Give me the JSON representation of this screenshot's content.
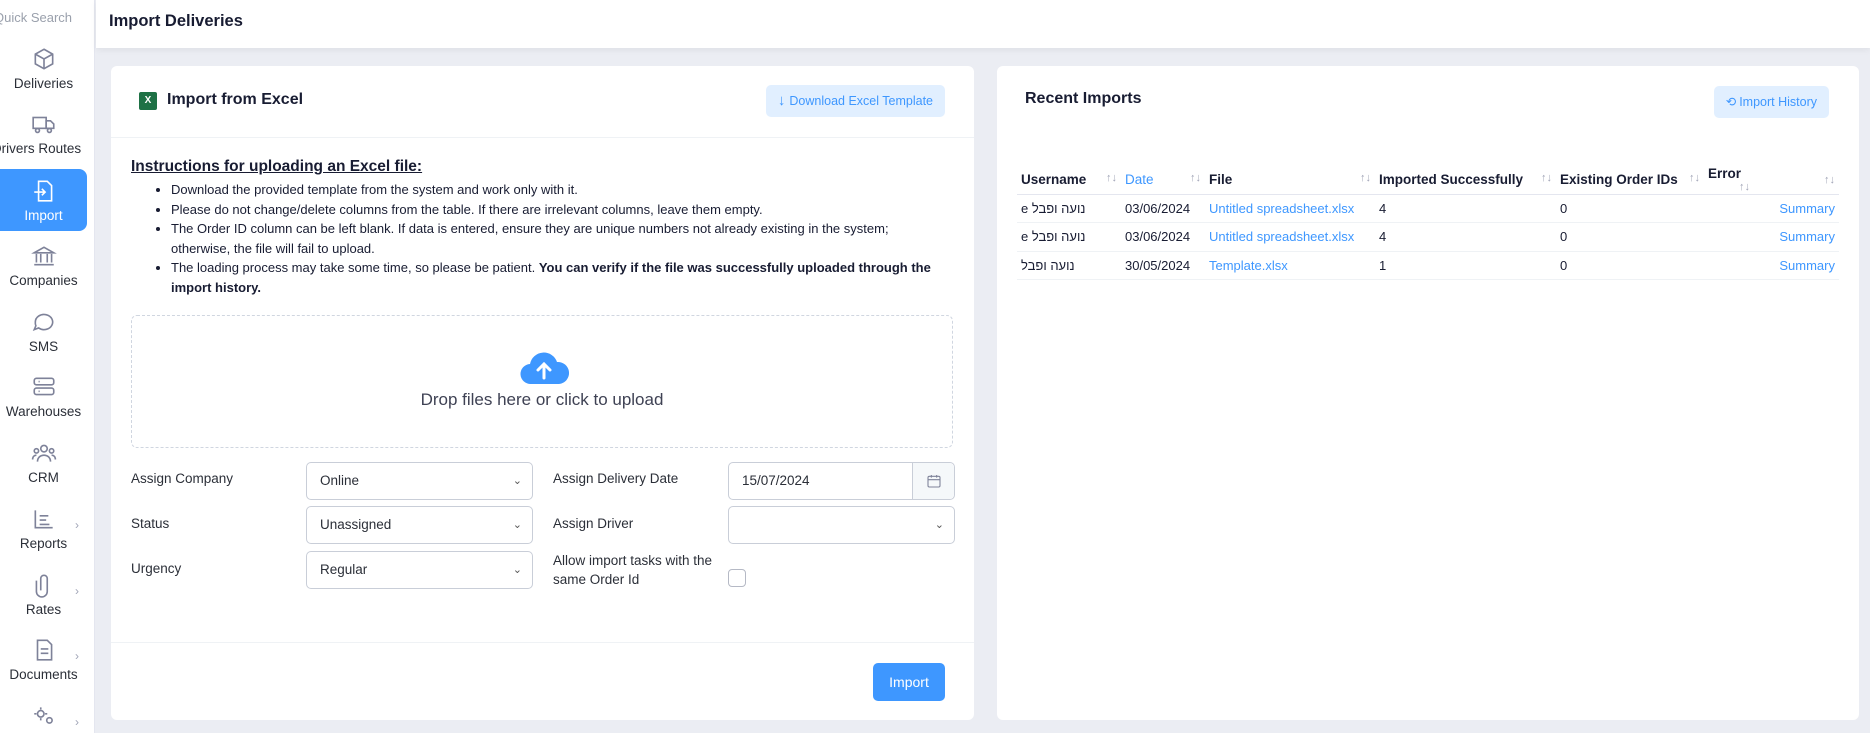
{
  "sidebar": {
    "search_placeholder": "Quick Search",
    "items": [
      {
        "label": "Deliveries",
        "icon": "box-icon"
      },
      {
        "label": "Drivers Routes",
        "icon": "truck-icon"
      },
      {
        "label": "Import",
        "icon": "import-icon",
        "active": true
      },
      {
        "label": "Companies",
        "icon": "bank-icon"
      },
      {
        "label": "SMS",
        "icon": "chat-icon"
      },
      {
        "label": "Warehouses",
        "icon": "server-icon"
      },
      {
        "label": "CRM",
        "icon": "users-icon"
      },
      {
        "label": "Reports",
        "icon": "chart-icon",
        "expandable": true
      },
      {
        "label": "Rates",
        "icon": "paperclip-icon",
        "expandable": true
      },
      {
        "label": "Documents",
        "icon": "document-icon",
        "expandable": true
      },
      {
        "label": "",
        "icon": "gears-icon",
        "expandable": true
      }
    ]
  },
  "header": {
    "title": "Import Deliveries"
  },
  "import_card": {
    "title": "Import from Excel",
    "download_label": "Download Excel Template",
    "instructions_title": "Instructions for uploading an Excel file:",
    "instructions": [
      "Download the provided template from the system and work only with it.",
      "Please do not change/delete columns from the table. If there are irrelevant columns, leave them empty.",
      "The Order ID column can be left blank. If data is entered, ensure they are unique numbers not already existing in the system; otherwise, the file will fail to upload.",
      "The loading process may take some time, so please be patient."
    ],
    "instructions_bold": "You can verify if the file was successfully uploaded through the import history.",
    "drop_text": "Drop files here or click to upload",
    "form": {
      "company_label": "Assign Company",
      "company_value": "Online",
      "status_label": "Status",
      "status_value": "Unassigned",
      "urgency_label": "Urgency",
      "urgency_value": "Regular",
      "date_label": "Assign Delivery Date",
      "date_value": "15/07/2024",
      "driver_label": "Assign Driver",
      "driver_value": "",
      "allow_label": "Allow import tasks with the same Order Id"
    },
    "import_button": "Import"
  },
  "recent_card": {
    "title": "Recent Imports",
    "history_button": "Import History",
    "columns": [
      "Username",
      "Date",
      "File",
      "Imported Successfully",
      "Existing Order IDs",
      "Error",
      ""
    ],
    "rows": [
      {
        "username": "e נועה ופבל",
        "date": "03/06/2024",
        "file": "Untitled spreadsheet.xlsx",
        "imported": "4",
        "existing": "0",
        "error": "",
        "action": "Summary"
      },
      {
        "username": "e נועה ופבל",
        "date": "03/06/2024",
        "file": "Untitled spreadsheet.xlsx",
        "imported": "4",
        "existing": "0",
        "error": "",
        "action": "Summary"
      },
      {
        "username": "נועה ופבל",
        "date": "30/05/2024",
        "file": "Template.xlsx",
        "imported": "1",
        "existing": "0",
        "error": "",
        "action": "Summary"
      }
    ]
  },
  "colors": {
    "accent": "#3e97ff",
    "accent_light": "#e1efff",
    "excel_green": "#1e7145"
  }
}
